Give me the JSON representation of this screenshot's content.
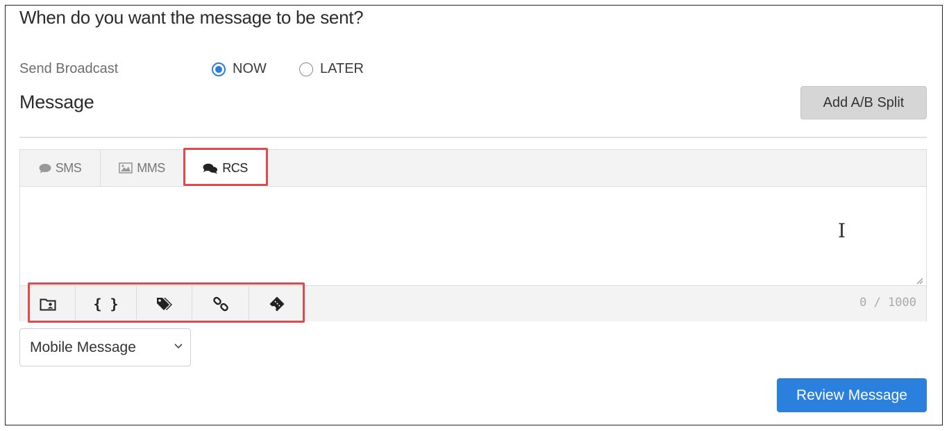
{
  "question": "When do you want the message to be sent?",
  "send_broadcast": {
    "label": "Send Broadcast",
    "options": [
      {
        "label": "NOW",
        "selected": true
      },
      {
        "label": "LATER",
        "selected": false
      }
    ]
  },
  "message": {
    "title": "Message",
    "ab_split_label": "Add A/B Split"
  },
  "tabs": [
    {
      "label": "SMS",
      "icon": "comment-icon"
    },
    {
      "label": "MMS",
      "icon": "image-icon"
    },
    {
      "label": "RCS",
      "icon": "comments-icon",
      "active": true
    }
  ],
  "editor": {
    "text": "",
    "counter": "0 / 1000"
  },
  "toolbar": [
    {
      "name": "contact-card-icon"
    },
    {
      "name": "curly-braces-icon",
      "label": "{ }"
    },
    {
      "name": "tags-icon"
    },
    {
      "name": "link-icon"
    },
    {
      "name": "ticket-icon"
    }
  ],
  "message_type_select": {
    "value": "Mobile Message"
  },
  "review_button": "Review Message",
  "colors": {
    "accent": "#2b80dd",
    "highlight": "#e54848"
  }
}
